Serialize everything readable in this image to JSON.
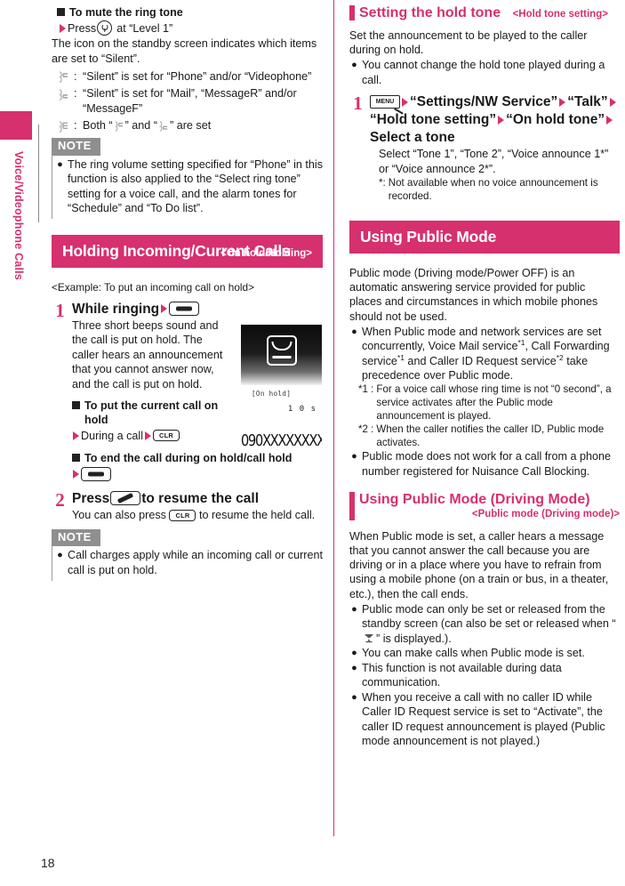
{
  "page": {
    "number": "18",
    "side_tab_label": "Voice/Videophone Calls",
    "accent_color": "#d6306e",
    "note_badge_color": "#8f8f8f"
  },
  "left_column": {
    "mute_section": {
      "heading": "To mute the ring tone",
      "action": "Press",
      "action_icon": "soft-key-down-icon",
      "action_tail": "at “Level 1”",
      "description": "The icon on the standby screen indicates which items are set to “Silent”.",
      "icon_legend": [
        {
          "icon": "silent-phone-icon",
          "separator": ":",
          "text": "“Silent” is set for “Phone” and/or “Videophone”"
        },
        {
          "icon": "silent-mail-icon",
          "separator": ":",
          "text": "“Silent” is set for “Mail”, “MessageR” and/or “MessageF”"
        },
        {
          "icon": "silent-both-icon",
          "separator": ":",
          "text": "Both “ ” and “ ” are set"
        }
      ]
    },
    "note_1": {
      "badge": "NOTE",
      "items": [
        "The ring volume setting specified for “Phone” in this function is also applied to the “Select ring tone” setting for a voice call, and the alarm tones for “Schedule” and “To Do list”."
      ]
    },
    "banner": {
      "title": "Holding Incoming/Current Calls",
      "subtitle": "<On hold/Holding>"
    },
    "example_line": "<Example: To put an incoming call on hold>",
    "step_1": {
      "number": "1",
      "title_text": "While ringing",
      "title_arrow": "triangle-right-icon",
      "title_key": "end-call-key-icon",
      "body": "Three short beeps sound and the call is put on hold. The caller hears an announcement that you cannot answer now, and the call is put on hold.",
      "sub_1": {
        "heading": "To put the current call on hold",
        "action_text": "During a call",
        "action_key": "CLR"
      },
      "sub_2": {
        "heading": "To end the call during on hold/call hold",
        "action_key": "end-call-key-icon"
      },
      "screenshot": {
        "status_label": "[On hold]",
        "timer": "1 0 s",
        "phone_number": "090XXXXXXXXX",
        "icon": "call-on-hold-icon"
      }
    },
    "step_2": {
      "number": "2",
      "title_prefix": "Press",
      "title_key": "call-key-icon",
      "title_suffix": "to resume the call",
      "body_prefix": "You can also press",
      "body_key": "CLR",
      "body_suffix": "to resume the held call."
    },
    "note_2": {
      "badge": "NOTE",
      "items": [
        "Call charges apply while an incoming call or current call is put on hold."
      ]
    }
  },
  "right_column": {
    "hold_tone_section": {
      "title": "Setting the hold tone",
      "subtitle": "<Hold tone setting>",
      "intro": "Set the announcement to be played to the caller during on hold.",
      "bullets": [
        "You cannot change the hold tone played during a call."
      ],
      "step_1": {
        "number": "1",
        "menu_key": "MENU",
        "path": [
          "“Settings/NW Service”",
          "“Talk”",
          "“Hold tone setting”",
          "“On hold tone”",
          "Select a tone"
        ],
        "body": "Select “Tone 1”, “Tone 2”, “Voice announce 1*” or “Voice announce 2*”.",
        "footnote_key": "*:",
        "footnote_text": "Not available when no voice announcement is recorded."
      }
    },
    "public_mode_banner": {
      "title": "Using Public Mode"
    },
    "public_mode_intro": "Public mode (Driving mode/Power OFF) is an automatic answering service provided for public places and circumstances in which mobile phones should not be used.",
    "public_mode_bullets": [
      {
        "text_parts": [
          "When Public mode and network services are set concurrently, Voice Mail service",
          "*1",
          ", Call Forwarding service",
          "*1",
          " and Caller ID Request service",
          "*2",
          " take precedence over Public mode."
        ],
        "footnotes": [
          {
            "key": "*1 :",
            "text": "For a voice call whose ring time is not “0 second”, a service activates after the Public mode announcement is played."
          },
          {
            "key": "*2 :",
            "text": "When the caller notifies the caller ID, Public mode activates."
          }
        ]
      },
      {
        "text_parts": [
          "Public mode does not work for a call from a phone number registered for Nuisance Call Blocking."
        ],
        "footnotes": []
      }
    ],
    "driving_mode_section": {
      "title": "Using Public Mode (Driving Mode)",
      "subtitle": "<Public mode (Driving mode)>",
      "intro": "When Public mode is set, a caller hears a message that you cannot answer the call because you are driving or in a place where you have to refrain from using a mobile phone (on a train or bus, in a theater, etc.), then the call ends.",
      "bullets": [
        "Public mode can only be set or released from the standby screen (can also be set or released when “ ” is displayed.).",
        "You can make calls when Public mode is set.",
        "This function is not available during data communication.",
        "When you receive a call with no caller ID while Caller ID Request service is set to “Activate”, the caller ID request announcement is played (Public mode announcement is not played.)"
      ]
    }
  }
}
